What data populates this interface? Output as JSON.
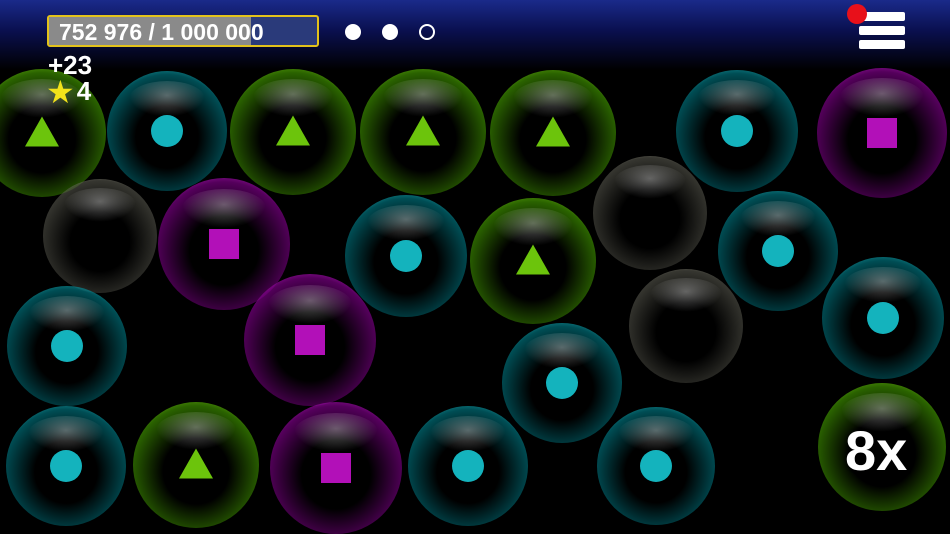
{
  "hud": {
    "progress_text": "752 976 / 1 000 000",
    "progress_fraction": 0.752976,
    "score_delta": "+23",
    "star_icon": "star-icon",
    "star_count": "4",
    "multiplier": "8x",
    "level_dots": [
      true,
      true,
      false
    ],
    "menu_icon": "hamburger-menu-icon",
    "notification_color": "#e8101a"
  },
  "colors": {
    "green": "#6cc40c",
    "cyan": "#14b3bd",
    "magenta": "#b210b8",
    "progress_border": "#e3c21a",
    "star": "#f2e21a"
  },
  "bubbles": [
    {
      "color": "green",
      "symbol": "triangle"
    },
    {
      "color": "cyan",
      "symbol": "circle"
    },
    {
      "color": "green",
      "symbol": "triangle"
    },
    {
      "color": "green",
      "symbol": "triangle"
    },
    {
      "color": "green",
      "symbol": "triangle"
    },
    {
      "color": "cyan",
      "symbol": "circle"
    },
    {
      "color": "magenta",
      "symbol": "square"
    },
    {
      "color": "empty",
      "symbol": "none"
    },
    {
      "color": "magenta",
      "symbol": "square"
    },
    {
      "color": "cyan",
      "symbol": "circle"
    },
    {
      "color": "green",
      "symbol": "triangle"
    },
    {
      "color": "empty",
      "symbol": "none"
    },
    {
      "color": "cyan",
      "symbol": "circle"
    },
    {
      "color": "cyan",
      "symbol": "circle"
    },
    {
      "color": "magenta",
      "symbol": "square"
    },
    {
      "color": "empty",
      "symbol": "none"
    },
    {
      "color": "cyan",
      "symbol": "circle"
    },
    {
      "color": "cyan",
      "symbol": "circle"
    },
    {
      "color": "cyan",
      "symbol": "circle"
    },
    {
      "color": "green",
      "symbol": "triangle"
    },
    {
      "color": "magenta",
      "symbol": "square"
    },
    {
      "color": "cyan",
      "symbol": "circle"
    },
    {
      "color": "cyan",
      "symbol": "circle"
    },
    {
      "color": "green",
      "symbol": "none"
    }
  ]
}
